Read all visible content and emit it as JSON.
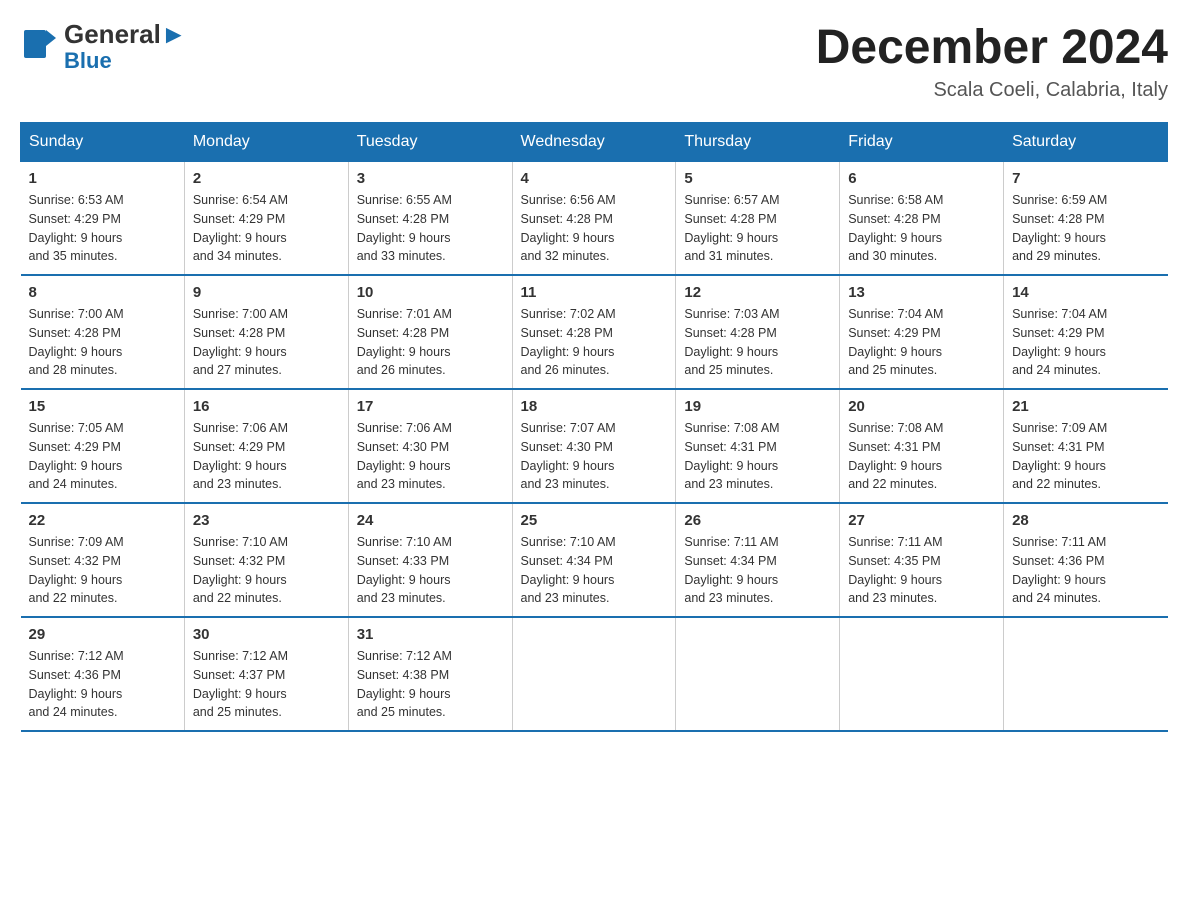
{
  "header": {
    "logo_general": "General",
    "logo_blue": "Blue",
    "month_title": "December 2024",
    "location": "Scala Coeli, Calabria, Italy"
  },
  "days_of_week": [
    "Sunday",
    "Monday",
    "Tuesday",
    "Wednesday",
    "Thursday",
    "Friday",
    "Saturday"
  ],
  "weeks": [
    [
      {
        "day": "1",
        "sunrise": "6:53 AM",
        "sunset": "4:29 PM",
        "daylight": "9 hours and 35 minutes."
      },
      {
        "day": "2",
        "sunrise": "6:54 AM",
        "sunset": "4:29 PM",
        "daylight": "9 hours and 34 minutes."
      },
      {
        "day": "3",
        "sunrise": "6:55 AM",
        "sunset": "4:28 PM",
        "daylight": "9 hours and 33 minutes."
      },
      {
        "day": "4",
        "sunrise": "6:56 AM",
        "sunset": "4:28 PM",
        "daylight": "9 hours and 32 minutes."
      },
      {
        "day": "5",
        "sunrise": "6:57 AM",
        "sunset": "4:28 PM",
        "daylight": "9 hours and 31 minutes."
      },
      {
        "day": "6",
        "sunrise": "6:58 AM",
        "sunset": "4:28 PM",
        "daylight": "9 hours and 30 minutes."
      },
      {
        "day": "7",
        "sunrise": "6:59 AM",
        "sunset": "4:28 PM",
        "daylight": "9 hours and 29 minutes."
      }
    ],
    [
      {
        "day": "8",
        "sunrise": "7:00 AM",
        "sunset": "4:28 PM",
        "daylight": "9 hours and 28 minutes."
      },
      {
        "day": "9",
        "sunrise": "7:00 AM",
        "sunset": "4:28 PM",
        "daylight": "9 hours and 27 minutes."
      },
      {
        "day": "10",
        "sunrise": "7:01 AM",
        "sunset": "4:28 PM",
        "daylight": "9 hours and 26 minutes."
      },
      {
        "day": "11",
        "sunrise": "7:02 AM",
        "sunset": "4:28 PM",
        "daylight": "9 hours and 26 minutes."
      },
      {
        "day": "12",
        "sunrise": "7:03 AM",
        "sunset": "4:28 PM",
        "daylight": "9 hours and 25 minutes."
      },
      {
        "day": "13",
        "sunrise": "7:04 AM",
        "sunset": "4:29 PM",
        "daylight": "9 hours and 25 minutes."
      },
      {
        "day": "14",
        "sunrise": "7:04 AM",
        "sunset": "4:29 PM",
        "daylight": "9 hours and 24 minutes."
      }
    ],
    [
      {
        "day": "15",
        "sunrise": "7:05 AM",
        "sunset": "4:29 PM",
        "daylight": "9 hours and 24 minutes."
      },
      {
        "day": "16",
        "sunrise": "7:06 AM",
        "sunset": "4:29 PM",
        "daylight": "9 hours and 23 minutes."
      },
      {
        "day": "17",
        "sunrise": "7:06 AM",
        "sunset": "4:30 PM",
        "daylight": "9 hours and 23 minutes."
      },
      {
        "day": "18",
        "sunrise": "7:07 AM",
        "sunset": "4:30 PM",
        "daylight": "9 hours and 23 minutes."
      },
      {
        "day": "19",
        "sunrise": "7:08 AM",
        "sunset": "4:31 PM",
        "daylight": "9 hours and 23 minutes."
      },
      {
        "day": "20",
        "sunrise": "7:08 AM",
        "sunset": "4:31 PM",
        "daylight": "9 hours and 22 minutes."
      },
      {
        "day": "21",
        "sunrise": "7:09 AM",
        "sunset": "4:31 PM",
        "daylight": "9 hours and 22 minutes."
      }
    ],
    [
      {
        "day": "22",
        "sunrise": "7:09 AM",
        "sunset": "4:32 PM",
        "daylight": "9 hours and 22 minutes."
      },
      {
        "day": "23",
        "sunrise": "7:10 AM",
        "sunset": "4:32 PM",
        "daylight": "9 hours and 22 minutes."
      },
      {
        "day": "24",
        "sunrise": "7:10 AM",
        "sunset": "4:33 PM",
        "daylight": "9 hours and 23 minutes."
      },
      {
        "day": "25",
        "sunrise": "7:10 AM",
        "sunset": "4:34 PM",
        "daylight": "9 hours and 23 minutes."
      },
      {
        "day": "26",
        "sunrise": "7:11 AM",
        "sunset": "4:34 PM",
        "daylight": "9 hours and 23 minutes."
      },
      {
        "day": "27",
        "sunrise": "7:11 AM",
        "sunset": "4:35 PM",
        "daylight": "9 hours and 23 minutes."
      },
      {
        "day": "28",
        "sunrise": "7:11 AM",
        "sunset": "4:36 PM",
        "daylight": "9 hours and 24 minutes."
      }
    ],
    [
      {
        "day": "29",
        "sunrise": "7:12 AM",
        "sunset": "4:36 PM",
        "daylight": "9 hours and 24 minutes."
      },
      {
        "day": "30",
        "sunrise": "7:12 AM",
        "sunset": "4:37 PM",
        "daylight": "9 hours and 25 minutes."
      },
      {
        "day": "31",
        "sunrise": "7:12 AM",
        "sunset": "4:38 PM",
        "daylight": "9 hours and 25 minutes."
      },
      {
        "day": "",
        "sunrise": "",
        "sunset": "",
        "daylight": ""
      },
      {
        "day": "",
        "sunrise": "",
        "sunset": "",
        "daylight": ""
      },
      {
        "day": "",
        "sunrise": "",
        "sunset": "",
        "daylight": ""
      },
      {
        "day": "",
        "sunrise": "",
        "sunset": "",
        "daylight": ""
      }
    ]
  ],
  "labels": {
    "sunrise": "Sunrise:",
    "sunset": "Sunset:",
    "daylight": "Daylight:"
  }
}
